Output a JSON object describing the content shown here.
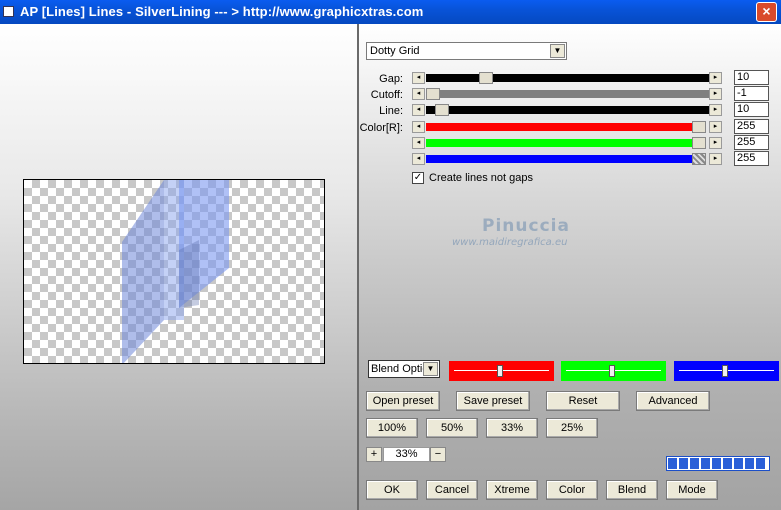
{
  "window": {
    "title": "AP [Lines]  Lines - SilverLining      --- > http://www.graphicxtras.com",
    "close_label": "×"
  },
  "controls": {
    "preset": "Dotty Grid",
    "sliders": [
      {
        "label": "Gap:",
        "value": "10",
        "fill": 0.5,
        "color": "#000000"
      },
      {
        "label": "Cutoff:",
        "value": "-1",
        "fill": 0.0,
        "color": "#808080"
      },
      {
        "label": "Line:",
        "value": "10",
        "fill": 0.03,
        "color": "#000000"
      },
      {
        "label": "Color[R]:",
        "value": "255",
        "fill": 1.0,
        "color": "#ff0000"
      },
      {
        "label": "",
        "value": "255",
        "fill": 1.0,
        "color": "#00ff00"
      },
      {
        "label": "",
        "value": "255",
        "fill": 1.0,
        "color": "#0000ff"
      }
    ],
    "checkbox_label": "Create lines not gaps",
    "checkbox_checked": true
  },
  "watermark": {
    "name": "Pinuccia",
    "url": "www.maidiregrafica.eu"
  },
  "blend": {
    "select_value": "Blend Optio",
    "boxes": [
      {
        "color": "#ff0000",
        "level": 0.5
      },
      {
        "color": "#00ff00",
        "level": 0.5
      },
      {
        "color": "#0000ff",
        "level": 0.5
      }
    ]
  },
  "buttons": {
    "open_preset": "Open preset",
    "save_preset": "Save preset",
    "reset": "Reset",
    "advanced": "Advanced",
    "zoom100": "100%",
    "zoom50": "50%",
    "zoom33": "33%",
    "zoom25": "25%",
    "ok": "OK",
    "cancel": "Cancel",
    "xtreme": "Xtreme",
    "color": "Color",
    "blend": "Blend",
    "mode": "Mode"
  },
  "zoom": {
    "plus": "+",
    "value": "33%",
    "minus": "−"
  },
  "progress_cells": 9
}
